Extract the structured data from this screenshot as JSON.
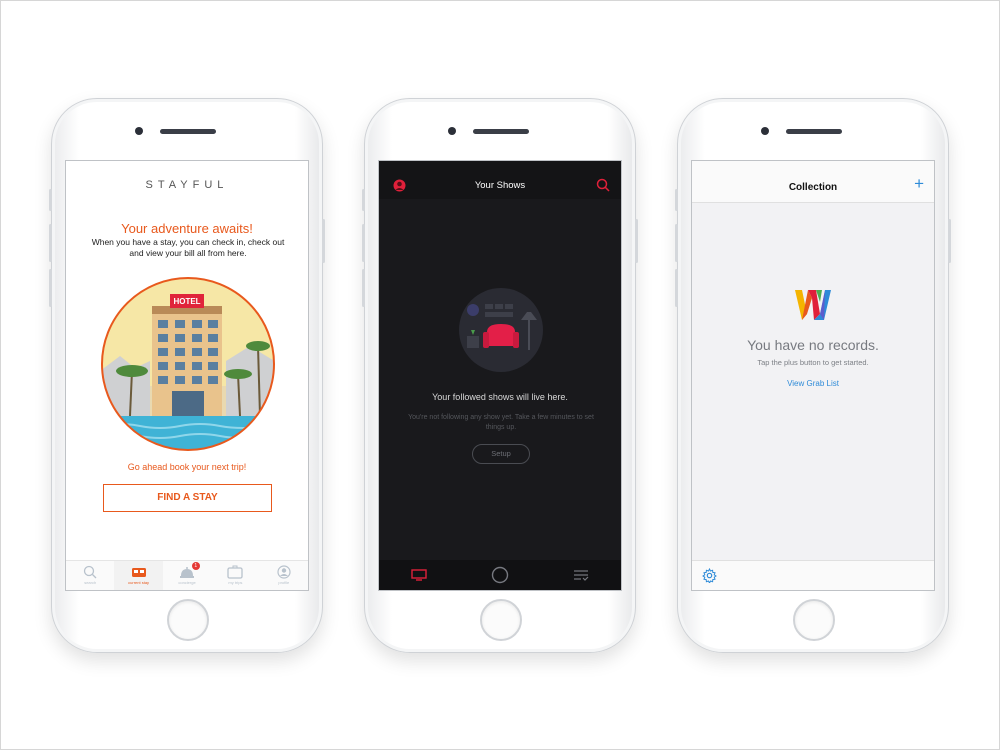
{
  "phone1": {
    "brand": "STAYFUL",
    "headline": "Your adventure awaits!",
    "subtext": "When you have a stay, you can check in, check out and view your bill all from here.",
    "hotel_sign": "HOTEL",
    "cta_text": "Go ahead book your next trip!",
    "find_button": "FIND A STAY",
    "accent_color": "#e8591d",
    "tabs": [
      {
        "label": "search",
        "icon": "search-icon"
      },
      {
        "label": "current stay",
        "icon": "bed-icon",
        "active": true
      },
      {
        "label": "concierge",
        "icon": "bell-icon",
        "badge": "1"
      },
      {
        "label": "my trips",
        "icon": "suitcase-icon"
      },
      {
        "label": "profile",
        "icon": "profile-icon"
      }
    ]
  },
  "phone2": {
    "title": "Your Shows",
    "empty_title": "Your followed shows will live here.",
    "empty_body": "You're not following any show yet. Take a few minutes to set things up.",
    "setup_button": "Setup",
    "accent_color": "#e0203a",
    "tabs": [
      {
        "icon": "tv-icon",
        "active": true
      },
      {
        "icon": "circle-icon"
      },
      {
        "icon": "list-check-icon"
      }
    ]
  },
  "phone3": {
    "title": "Collection",
    "add_label": "+",
    "empty_title": "You have no records.",
    "empty_hint": "Tap the plus button to get started.",
    "link": "View Grab List",
    "accent_color": "#2e8bd8"
  }
}
